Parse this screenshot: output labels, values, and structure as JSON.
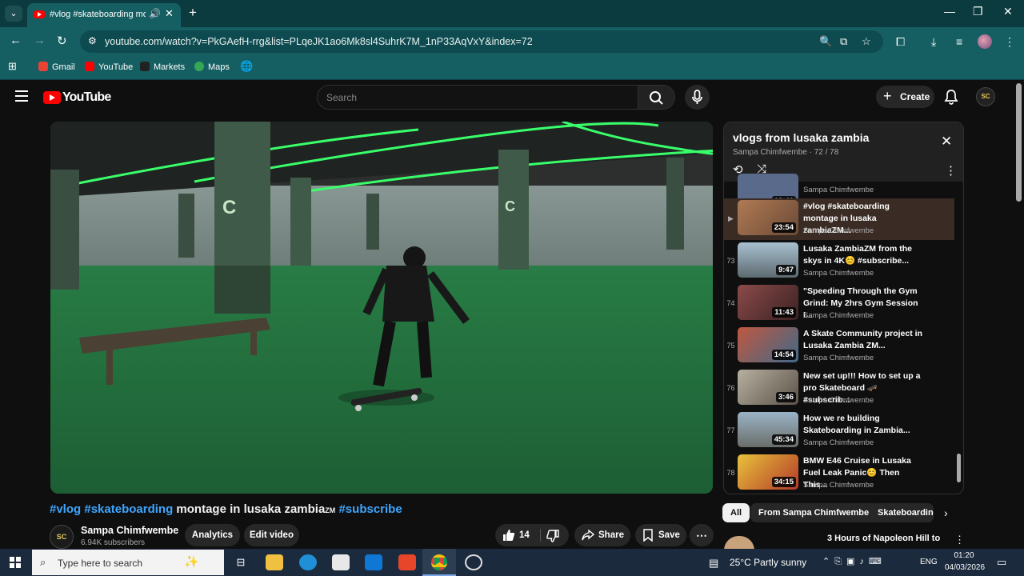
{
  "browser": {
    "tab_title": "#vlog #skateboarding mon",
    "url": "youtube.com/watch?v=PkGAefH-rrg&list=PLqeJK1ao6Mk8sl4SuhrK7M_1nP33AqVxY&index=72",
    "bookmarks": [
      {
        "label": "Gmail",
        "icon": "gmail-icon",
        "color": "#ea4335"
      },
      {
        "label": "YouTube",
        "icon": "youtube-icon",
        "color": "#ff0000"
      },
      {
        "label": "Markets",
        "icon": "markets-icon",
        "color": "#222222"
      },
      {
        "label": "Maps",
        "icon": "maps-icon",
        "color": "#34a853"
      }
    ]
  },
  "youtube": {
    "logo_text": "YouTube",
    "search_placeholder": "Search",
    "create_label": "Create",
    "avatar_text": "SC"
  },
  "video": {
    "title_tag1": "#vlog",
    "title_tag2": "#skateboarding",
    "title_mid": "montage in lusaka zambia",
    "title_zm": "ZM",
    "title_tag3": "#subscribe",
    "channel_initials": "SC",
    "channel_name": "Sampa Chimfwembe",
    "subscribers": "6.94K subscribers",
    "analytics_label": "Analytics",
    "edit_label": "Edit video",
    "likes": "14",
    "share_label": "Share",
    "save_label": "Save"
  },
  "playlist": {
    "title": "vlogs from lusaka zambia",
    "subtitle": "Sampa Chimfwembe · 72 / 78",
    "items": [
      {
        "index": "",
        "duration": "12:41",
        "title": "",
        "channel": "Sampa Chimfwembe",
        "thumb": "#5a6a8a"
      },
      {
        "index": "▶",
        "duration": "23:54",
        "title": "#vlog #skateboarding montage in lusaka zambiaZM...",
        "channel": "Sampa Chimfwembe",
        "thumb": "#8a6b4e"
      },
      {
        "index": "73",
        "duration": "9:47",
        "title": "Lusaka ZambiaZM from the skys in 4K😊 #subscribe...",
        "channel": "Sampa Chimfwembe",
        "thumb": "#6f7c86"
      },
      {
        "index": "74",
        "duration": "11:43",
        "title": "\"Speeding Through the Gym Grind: My 2hrs Gym Session I...",
        "channel": "Sampa Chimfwembe",
        "thumb": "#7a3d3d"
      },
      {
        "index": "75",
        "duration": "14:54",
        "title": "A Skate Community project in Lusaka Zambia ZM...",
        "channel": "Sampa Chimfwembe",
        "thumb": "#a04a3a"
      },
      {
        "index": "76",
        "duration": "3:46",
        "title": "New set up!!! How to set up a pro Skateboard 🛹 #subscrib...",
        "channel": "Sampa Chimfwembe",
        "thumb": "#8c8478"
      },
      {
        "index": "77",
        "duration": "45:34",
        "title": "How we re building Skateboarding in Zambia...",
        "channel": "Sampa Chimfwembe",
        "thumb": "#7d8a92"
      },
      {
        "index": "78",
        "duration": "34:15",
        "title": "BMW E46 Cruise in Lusaka Fuel Leak Panic😊 Then This...",
        "channel": "Sampa Chimfwembe",
        "thumb": "#c9a23a"
      }
    ]
  },
  "chips": [
    "All",
    "From Sampa Chimfwembe",
    "Skateboarding"
  ],
  "recommended_peek": "3 Hours of Napoleon Hill to",
  "taskbar": {
    "search_placeholder": "Type here to search",
    "weather": "25°C  Partly sunny",
    "lang": "ENG",
    "time": "01:20",
    "date": "04/03/2026"
  }
}
